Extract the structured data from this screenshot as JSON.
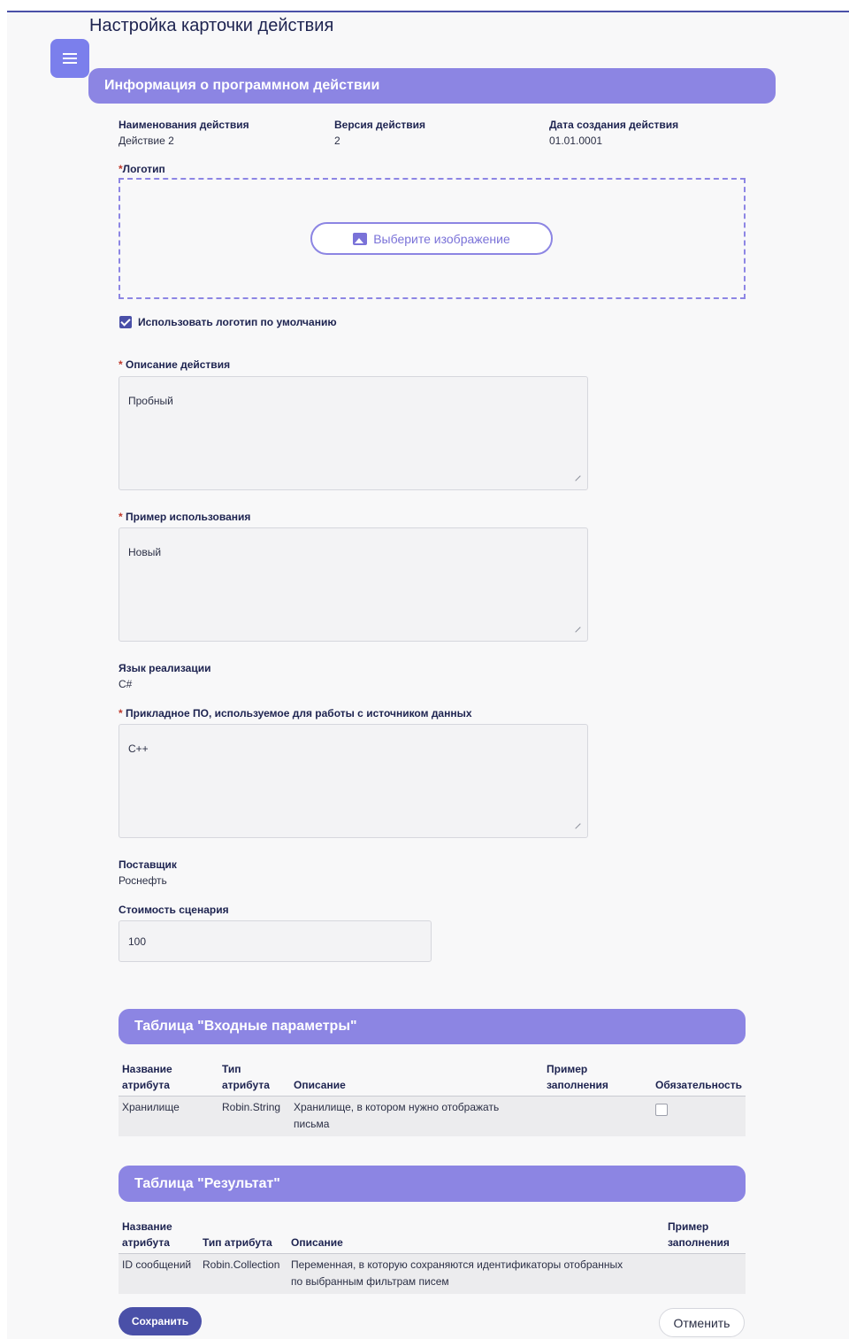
{
  "page": {
    "title": "Настройка карточки действия"
  },
  "info_section": {
    "title": "Информация о программном действии"
  },
  "fields": {
    "action_name": {
      "label": "Наименования действия",
      "value": "Действие 2"
    },
    "action_version": {
      "label": "Версия действия",
      "value": "2"
    },
    "created_date": {
      "label": "Дата создания действия",
      "value": "01.01.0001"
    },
    "logo": {
      "required_mark": "*",
      "label": "Логотип",
      "upload_button": "Выберите изображение",
      "use_default_label": "Использовать логотип по умолчанию",
      "use_default_checked": true
    },
    "description": {
      "required_mark": "*",
      "label": " Описание действия",
      "value": "Пробный"
    },
    "usage_example": {
      "required_mark": "*",
      "label": " Пример использования",
      "value": "Новый"
    },
    "language": {
      "label": "Язык реализации",
      "value": "C#"
    },
    "software": {
      "required_mark": "*",
      "label": " Прикладное ПО, используемое для работы с источником данных",
      "value": "C++"
    },
    "supplier": {
      "label": "Поставщик",
      "value": "Роснефть"
    },
    "cost": {
      "label": "Стоимость сценария",
      "value": "100"
    }
  },
  "input_table": {
    "title": "Таблица \"Входные параметры\"",
    "headers": {
      "name_1": "Название",
      "name_2": "атрибута",
      "type_1": "Тип",
      "type_2": "атрибута",
      "desc": "Описание",
      "example_1": "Пример",
      "example_2": "заполнения",
      "required": "Обязательность"
    },
    "rows": [
      {
        "name": "Хранилище",
        "type": "Robin.String",
        "desc_1": "Хранилище, в котором нужно отображать",
        "desc_2": "письма",
        "example": "",
        "required": false
      }
    ]
  },
  "result_table": {
    "title": "Таблица \"Результат\"",
    "headers": {
      "name_1": "Название",
      "name_2": "атрибута",
      "type": "Тип атрибута",
      "desc": "Описание",
      "example_1": "Пример",
      "example_2": "заполнения"
    },
    "rows": [
      {
        "name": "ID сообщений",
        "type": "Robin.Collection",
        "desc_1": "Переменная, в которую сохраняются идентификаторы отобранных",
        "desc_2": "по выбранным фильтрам писем",
        "example": ""
      }
    ]
  },
  "actions": {
    "save": "Сохранить",
    "cancel": "Отменить"
  },
  "colors": {
    "accent": "#8c85e3",
    "primary": "#4a50a8",
    "menu": "#7b7fec"
  },
  "icons": {
    "menu": "hamburger-icon",
    "upload": "image-icon",
    "checkbox": "check-icon"
  }
}
